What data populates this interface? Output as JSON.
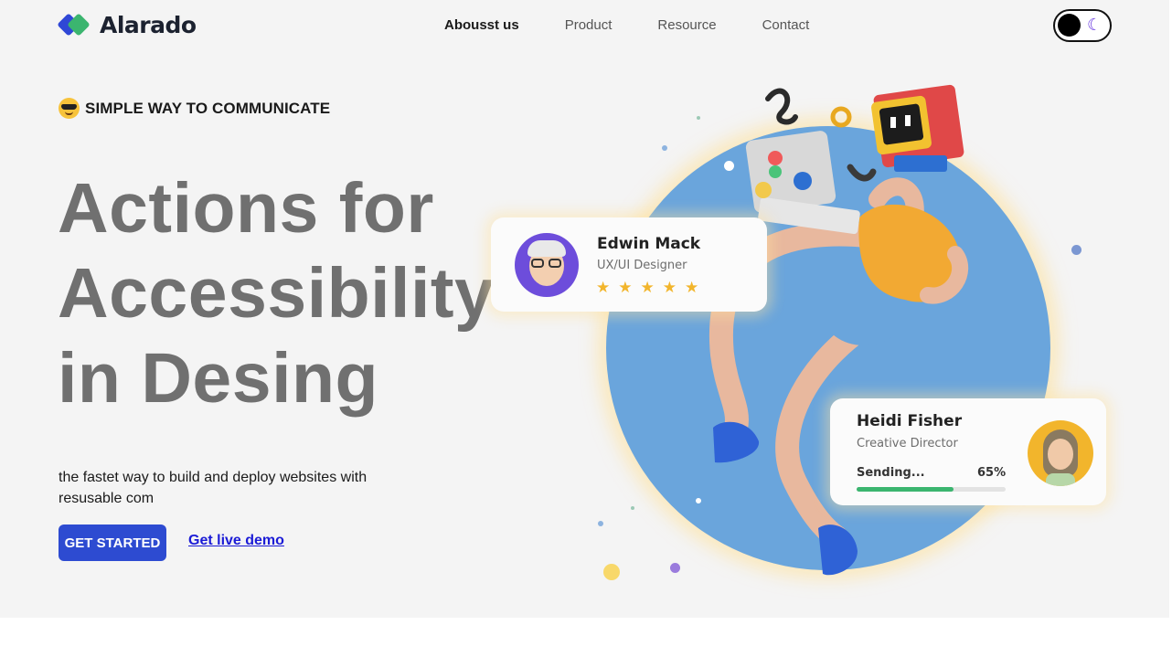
{
  "header": {
    "brand": "Alarado",
    "nav": [
      {
        "label": "Abousst us",
        "active": true
      },
      {
        "label": "Product",
        "active": false
      },
      {
        "label": "Resource",
        "active": false
      },
      {
        "label": "Contact",
        "active": false
      }
    ],
    "theme_icon": "moon-icon"
  },
  "hero": {
    "tagline": "SIMPLE WAY TO COMMUNICATE",
    "tagline_icon": "cool-emoji-icon",
    "headline_lines": [
      "Actions for",
      "Accessibility",
      "in Desing"
    ],
    "subtext": "the fastet way to build and deploy websites with resusable com",
    "cta_label": "GET STARTED",
    "demo_label": "Get live demo"
  },
  "cards": {
    "edwin": {
      "name": "Edwin Mack",
      "role": "UX/UI Designer",
      "stars": [
        "★",
        "★",
        "★",
        "★",
        "★"
      ]
    },
    "heidi": {
      "name": "Heidi Fisher",
      "role": "Creative Director",
      "status": "Sending...",
      "progress_label": "65%",
      "progress": 0.65
    }
  },
  "colors": {
    "brand_blue": "#2d4bd1",
    "brand_green": "#3bb56f",
    "headline_gray": "#707070",
    "circle_blue": "#6aa5dc",
    "star_gold": "#f2b52c"
  }
}
